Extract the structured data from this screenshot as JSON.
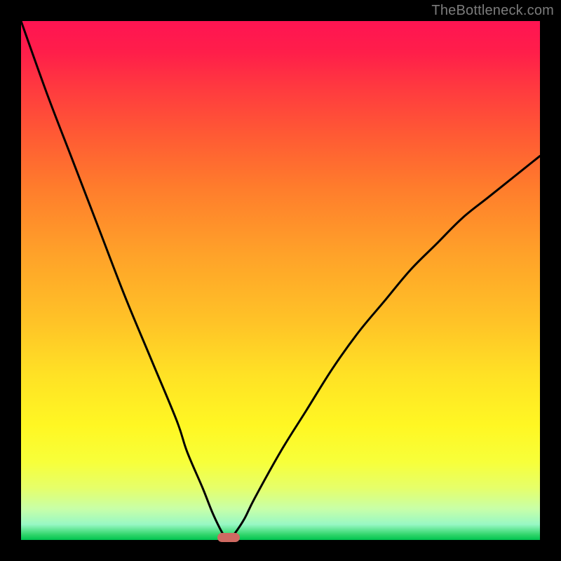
{
  "watermark": "TheBottleneck.com",
  "chart_data": {
    "type": "line",
    "title": "",
    "xlabel": "",
    "ylabel": "",
    "xlim": [
      0,
      100
    ],
    "ylim": [
      0,
      100
    ],
    "grid": false,
    "series": [
      {
        "name": "bottleneck-curve",
        "x": [
          0,
          5,
          10,
          15,
          20,
          25,
          30,
          32,
          35,
          37,
          39,
          40,
          41,
          43,
          45,
          50,
          55,
          60,
          65,
          70,
          75,
          80,
          85,
          90,
          95,
          100
        ],
        "values": [
          100,
          86,
          73,
          60,
          47,
          35,
          23,
          17,
          10,
          5,
          1,
          0,
          1,
          4,
          8,
          17,
          25,
          33,
          40,
          46,
          52,
          57,
          62,
          66,
          70,
          74
        ]
      }
    ],
    "marker": {
      "x": 40,
      "y": 0
    },
    "gradient_stops": [
      {
        "pos": 0,
        "color": "#ff1452"
      },
      {
        "pos": 50,
        "color": "#ffe125"
      },
      {
        "pos": 100,
        "color": "#00c34f"
      }
    ]
  }
}
